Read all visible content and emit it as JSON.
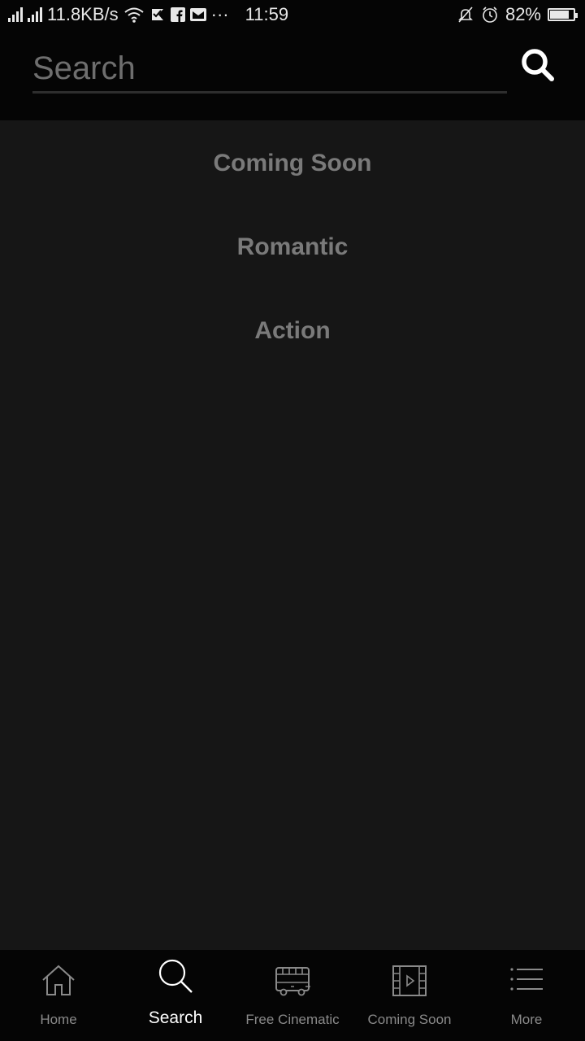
{
  "status_bar": {
    "net_speed": "11.8KB/s",
    "dots": "···",
    "time": "11:59",
    "battery_pct": "82%",
    "battery_level": 0.82,
    "icons": [
      "signal-icon",
      "signal-icon",
      "wifi-icon",
      "check-flag-icon",
      "facebook-icon",
      "mail-icon",
      "mute-bell-icon",
      "alarm-icon",
      "battery-icon"
    ]
  },
  "search": {
    "placeholder": "Search",
    "value": ""
  },
  "categories": [
    {
      "label": "Coming Soon"
    },
    {
      "label": "Romantic"
    },
    {
      "label": "Action"
    }
  ],
  "bottom_nav": {
    "items": [
      {
        "label": "Home",
        "icon": "home-icon",
        "active": false
      },
      {
        "label": "Search",
        "icon": "search-icon",
        "active": true
      },
      {
        "label": "Free Cinematic",
        "icon": "bus-icon",
        "active": false
      },
      {
        "label": "Coming Soon",
        "icon": "film-icon",
        "active": false
      },
      {
        "label": "More",
        "icon": "list-icon",
        "active": false
      }
    ]
  },
  "colors": {
    "background": "#161616",
    "bars": "#050505",
    "category_text": "#7a7a7a",
    "nav_inactive": "#8a8a8a",
    "nav_active": "#ffffff"
  }
}
